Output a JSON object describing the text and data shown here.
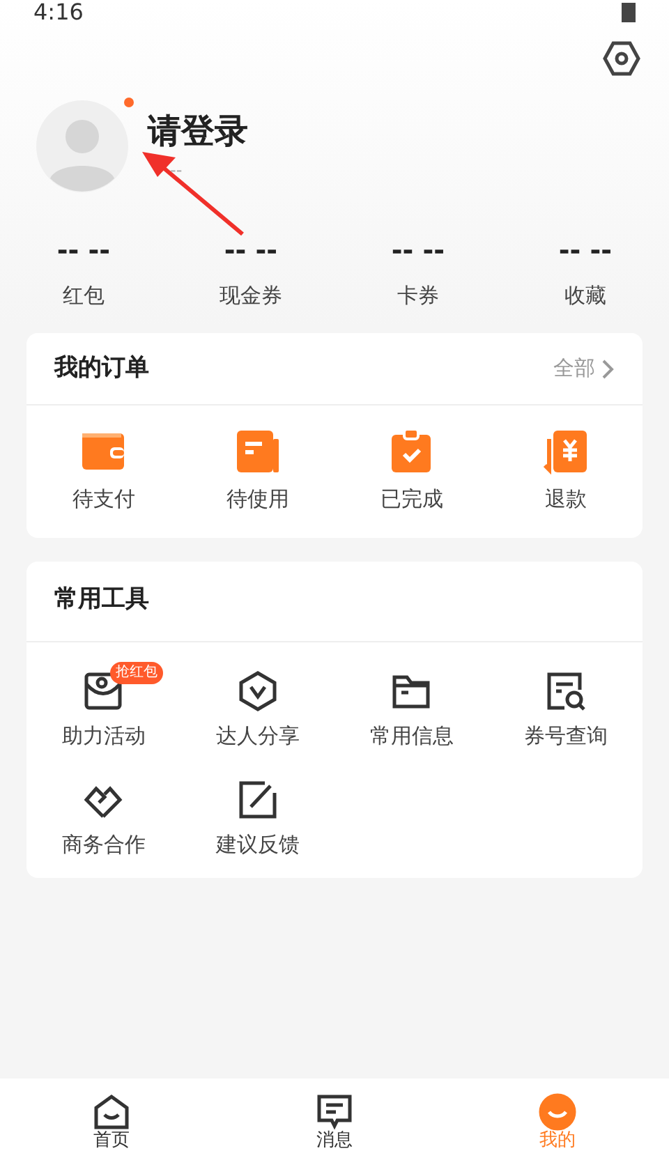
{
  "status_bar": {
    "time": "4:16"
  },
  "profile": {
    "name": "请登录",
    "subtitle": "--",
    "notification_dot": true
  },
  "stats": [
    {
      "value": "-- --",
      "label": "红包"
    },
    {
      "value": "-- --",
      "label": "现金券"
    },
    {
      "value": "-- --",
      "label": "卡券"
    },
    {
      "value": "-- --",
      "label": "收藏"
    }
  ],
  "orders": {
    "title": "我的订单",
    "link": "全部",
    "items": [
      {
        "kind": "wallet",
        "label": "待支付"
      },
      {
        "kind": "ticket",
        "label": "待使用"
      },
      {
        "kind": "clipboard",
        "label": "已完成"
      },
      {
        "kind": "refund",
        "label": "退款"
      }
    ]
  },
  "tools": {
    "title": "常用工具",
    "items": [
      {
        "kind": "activity",
        "label": "助力活动",
        "badge": "抢红包"
      },
      {
        "kind": "share",
        "label": "达人分享"
      },
      {
        "kind": "folder",
        "label": "常用信息"
      },
      {
        "kind": "receipt",
        "label": "券号查询"
      },
      {
        "kind": "handshake",
        "label": "商务合作"
      },
      {
        "kind": "edit",
        "label": "建议反馈"
      }
    ]
  },
  "bottom_nav": [
    {
      "kind": "home",
      "label": "首页",
      "selected": false
    },
    {
      "kind": "message",
      "label": "消息",
      "selected": false
    },
    {
      "kind": "me",
      "label": "我的",
      "selected": true
    }
  ]
}
